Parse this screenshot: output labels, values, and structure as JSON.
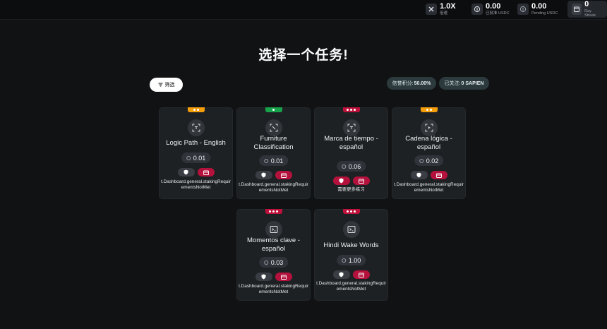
{
  "topbar": {
    "stats": [
      {
        "id": "multiplier",
        "value": "1.0X",
        "label": "倍速"
      },
      {
        "id": "paid",
        "value": "0.00",
        "label": "已批准 USDC"
      },
      {
        "id": "pending",
        "value": "0.00",
        "label": "Pending USDC"
      },
      {
        "id": "streak",
        "value": "0",
        "label": "Day Streak"
      }
    ]
  },
  "page": {
    "title": "选择一个任务!",
    "filter_label": "筛选",
    "reputation_label": "信誉积分:",
    "reputation_value": "50.00%",
    "followed_label": "已关注:",
    "followed_value": "0 SAPIEN"
  },
  "colors": {
    "tag_orange": "#f59e0b",
    "tag_green": "#16a34a",
    "tag_red": "#be123c"
  },
  "tasks": [
    {
      "name": "Logic Path - English",
      "reward": "0.01",
      "difficulty": "orange",
      "icon": "scan-icon",
      "note": "t.Dashboard.general.stakingRequirementsNotMet"
    },
    {
      "name": "Furniture Classification",
      "reward": "0.01",
      "difficulty": "green",
      "icon": "scan-icon",
      "note": "t.Dashboard.general.stakingRequirementsNotMet"
    },
    {
      "name": "Marca de tiempo - español",
      "reward": "0.06",
      "difficulty": "red",
      "icon": "scan-icon",
      "note": "需要更多练习"
    },
    {
      "name": "Cadena lógica - español",
      "reward": "0.02",
      "difficulty": "orange",
      "icon": "scan-cursor-icon",
      "note": "t.Dashboard.general.stakingRequirementsNotMet"
    },
    {
      "name": "Momentos clave - español",
      "reward": "0.03",
      "difficulty": "red",
      "icon": "terminal-icon",
      "note": "t.Dashboard.general.stakingRequirementsNotMet"
    },
    {
      "name": "Hindi Wake Words",
      "reward": "1.00",
      "difficulty": "red",
      "icon": "terminal-icon",
      "note": "t.Dashboard.general.stakingRequirementsNotMet"
    }
  ]
}
